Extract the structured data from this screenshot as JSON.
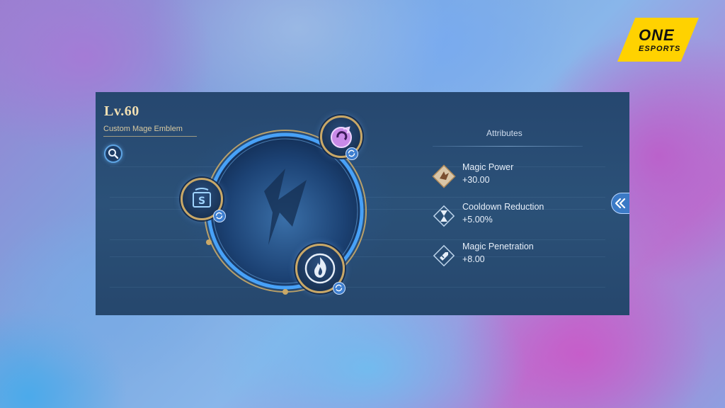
{
  "brand": {
    "line1": "ONE",
    "line2": "ESPORTS"
  },
  "emblem": {
    "level": "Lv.60",
    "name": "Custom Mage Emblem"
  },
  "talents": [
    {
      "icon": "magic-swirl-icon",
      "slot": "top"
    },
    {
      "icon": "coin-scroll-icon",
      "slot": "left"
    },
    {
      "icon": "flame-icon",
      "slot": "bottom"
    }
  ],
  "attributes": {
    "title": "Attributes",
    "items": [
      {
        "name": "Magic Power",
        "value": "+30.00",
        "icon": "magic-power-icon"
      },
      {
        "name": "Cooldown Reduction",
        "value": "+5.00%",
        "icon": "hourglass-icon"
      },
      {
        "name": "Magic Penetration",
        "value": "+8.00",
        "icon": "magic-penetration-icon"
      }
    ]
  },
  "colors": {
    "panel": "#2b5178",
    "gold": "#c9a867",
    "accent_blue": "#3b7ac6",
    "brand_yellow": "#ffd200"
  }
}
